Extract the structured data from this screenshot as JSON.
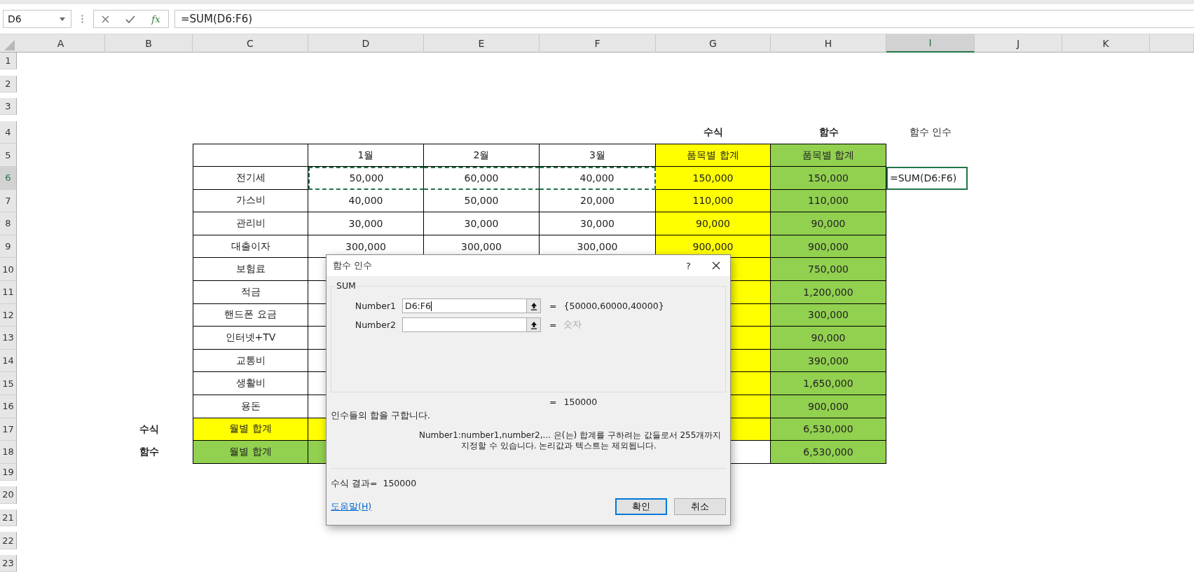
{
  "formula_bar": {
    "name_box": "D6",
    "function_icon": "fx",
    "formula": "=SUM(D6:F6)"
  },
  "sheet": {
    "columns": [
      {
        "label": "A",
        "selected": false
      },
      {
        "label": "B",
        "selected": false
      },
      {
        "label": "C",
        "selected": false
      },
      {
        "label": "D",
        "selected": false
      },
      {
        "label": "E",
        "selected": false
      },
      {
        "label": "F",
        "selected": false
      },
      {
        "label": "G",
        "selected": false
      },
      {
        "label": "H",
        "selected": false
      },
      {
        "label": "I",
        "selected": true
      },
      {
        "label": "J",
        "selected": false
      },
      {
        "label": "K",
        "selected": false
      }
    ],
    "rows": [
      {
        "label": "1",
        "selected": false
      },
      {
        "label": "2",
        "selected": false
      },
      {
        "label": "3",
        "selected": false
      },
      {
        "label": "4",
        "selected": false,
        "cells": [
          {},
          {},
          {},
          {},
          {},
          {
            "border": false,
            "text": "수식",
            "bold": true
          },
          {
            "border": false,
            "text": "함수",
            "bold": true
          },
          {
            "border": false,
            "text": "함수 인수",
            "bold": false
          }
        ]
      },
      {
        "label": "5",
        "selected": false,
        "cells": [
          {},
          {
            "border": true
          },
          {
            "border": true,
            "text": "1월"
          },
          {
            "border": true,
            "text": "2월"
          },
          {
            "border": true,
            "text": "3월"
          },
          {
            "border": true,
            "text": "품목별 합계",
            "color": "#ffff00"
          },
          {
            "border": true,
            "text": "품목별 합계",
            "color": "#92d050"
          }
        ]
      },
      {
        "label": "6",
        "selected": true,
        "cells": [
          {},
          {
            "border": true,
            "text": "전기세"
          },
          {
            "border": true,
            "text": "50,000",
            "marquee": true
          },
          {
            "border": true,
            "text": "60,000",
            "marquee": true
          },
          {
            "border": true,
            "text": "40,000",
            "marquee": true
          },
          {
            "border": true,
            "text": "150,000",
            "color": "#ffff00"
          },
          {
            "border": true,
            "text": "150,000",
            "color": "#92d050"
          },
          {
            "border": false,
            "text": "=SUM(D6:F6)",
            "active": true
          }
        ]
      },
      {
        "label": "7",
        "selected": false,
        "cells": [
          {},
          {
            "border": true,
            "text": "가스비"
          },
          {
            "border": true,
            "text": "40,000"
          },
          {
            "border": true,
            "text": "50,000"
          },
          {
            "border": true,
            "text": "20,000"
          },
          {
            "border": true,
            "text": "110,000",
            "color": "#ffff00"
          },
          {
            "border": true,
            "text": "110,000",
            "color": "#92d050"
          }
        ]
      },
      {
        "label": "8",
        "selected": false,
        "cells": [
          {},
          {
            "border": true,
            "text": "관리비"
          },
          {
            "border": true,
            "text": "30,000"
          },
          {
            "border": true,
            "text": "30,000"
          },
          {
            "border": true,
            "text": "30,000"
          },
          {
            "border": true,
            "text": "90,000",
            "color": "#ffff00"
          },
          {
            "border": true,
            "text": "90,000",
            "color": "#92d050"
          }
        ]
      },
      {
        "label": "9",
        "selected": false,
        "cells": [
          {},
          {
            "border": true,
            "text": "대출이자"
          },
          {
            "border": true,
            "text": "300,000"
          },
          {
            "border": true,
            "text": "300,000"
          },
          {
            "border": true,
            "text": "300,000"
          },
          {
            "border": true,
            "text": "900,000",
            "color": "#ffff00"
          },
          {
            "border": true,
            "text": "900,000",
            "color": "#92d050"
          }
        ]
      },
      {
        "label": "10",
        "selected": false,
        "cells": [
          {},
          {
            "border": true,
            "text": "보험료"
          },
          {
            "border": true
          },
          {},
          {},
          {
            "border": true,
            "color": "#ffff00"
          },
          {
            "border": true,
            "text": "750,000",
            "color": "#92d050"
          }
        ]
      },
      {
        "label": "11",
        "selected": false,
        "cells": [
          {},
          {
            "border": true,
            "text": "적금"
          },
          {
            "border": true
          },
          {},
          {},
          {
            "border": true,
            "color": "#ffff00"
          },
          {
            "border": true,
            "text": "1,200,000",
            "color": "#92d050"
          }
        ]
      },
      {
        "label": "12",
        "selected": false,
        "cells": [
          {},
          {
            "border": true,
            "text": "핸드폰 요금"
          },
          {
            "border": true
          },
          {},
          {},
          {
            "border": true,
            "color": "#ffff00"
          },
          {
            "border": true,
            "text": "300,000",
            "color": "#92d050"
          }
        ]
      },
      {
        "label": "13",
        "selected": false,
        "cells": [
          {},
          {
            "border": true,
            "text": "인터넷+TV"
          },
          {
            "border": true
          },
          {},
          {},
          {
            "border": true,
            "color": "#ffff00"
          },
          {
            "border": true,
            "text": "90,000",
            "color": "#92d050"
          }
        ]
      },
      {
        "label": "14",
        "selected": false,
        "cells": [
          {},
          {
            "border": true,
            "text": "교통비"
          },
          {
            "border": true
          },
          {},
          {},
          {
            "border": true,
            "color": "#ffff00"
          },
          {
            "border": true,
            "text": "390,000",
            "color": "#92d050"
          }
        ]
      },
      {
        "label": "15",
        "selected": false,
        "cells": [
          {},
          {
            "border": true,
            "text": "생활비"
          },
          {
            "border": true
          },
          {},
          {},
          {
            "border": true,
            "color": "#ffff00"
          },
          {
            "border": true,
            "text": "1,650,000",
            "color": "#92d050"
          }
        ]
      },
      {
        "label": "16",
        "selected": false,
        "cells": [
          {},
          {
            "border": true,
            "text": "용돈"
          },
          {
            "border": true
          },
          {},
          {},
          {
            "border": true,
            "color": "#ffff00"
          },
          {
            "border": true,
            "text": "900,000",
            "color": "#92d050"
          }
        ]
      },
      {
        "label": "17",
        "selected": false,
        "cells": [
          {
            "border": false,
            "text": "수식",
            "bold": true
          },
          {
            "border": true,
            "text": "월별 합계",
            "color": "#ffff00"
          },
          {
            "border": true,
            "color": "#ffff00"
          },
          {},
          {},
          {
            "border": true,
            "color": "#ffff00"
          },
          {
            "border": true,
            "text": "6,530,000",
            "color": "#92d050"
          }
        ]
      },
      {
        "label": "18",
        "selected": false,
        "cells": [
          {
            "border": false,
            "text": "함수",
            "bold": true
          },
          {
            "border": true,
            "text": "월별 합계",
            "color": "#92d050"
          },
          {
            "border": true,
            "color": "#92d050"
          },
          {},
          {},
          {
            "border": true
          },
          {
            "border": true,
            "text": "6,530,000",
            "color": "#92d050"
          }
        ]
      },
      {
        "label": "19",
        "selected": false
      },
      {
        "label": "20",
        "selected": false
      },
      {
        "label": "21",
        "selected": false
      },
      {
        "label": "22",
        "selected": false
      },
      {
        "label": "23",
        "selected": false
      }
    ]
  },
  "dialog": {
    "title": "함수 인수",
    "help": "?",
    "group": "SUM",
    "arguments": [
      {
        "label": "Number1",
        "value": "D6:F6",
        "equals": "=",
        "result": "{50000,60000,40000}",
        "dimmed": false
      },
      {
        "label": "Number2",
        "equals": "=",
        "result": "숫자",
        "dimmed": true
      }
    ],
    "total_equals": "=",
    "total": "150000",
    "description": "인수들의 합을 구합니다.",
    "argument_help_label": "Number1:",
    "argument_help": "number1,number2,... 은(는) 합계를 구하려는 값들로서 255개까지 지정할 수 있습니다. 논리값과 텍스트는 제외됩니다.",
    "result_label": "수식 결과=",
    "result": "150000",
    "help_link": "도움말(H)",
    "buttons": [
      {
        "label": "확인",
        "default": true
      },
      {
        "label": "취소",
        "default": false
      }
    ]
  }
}
